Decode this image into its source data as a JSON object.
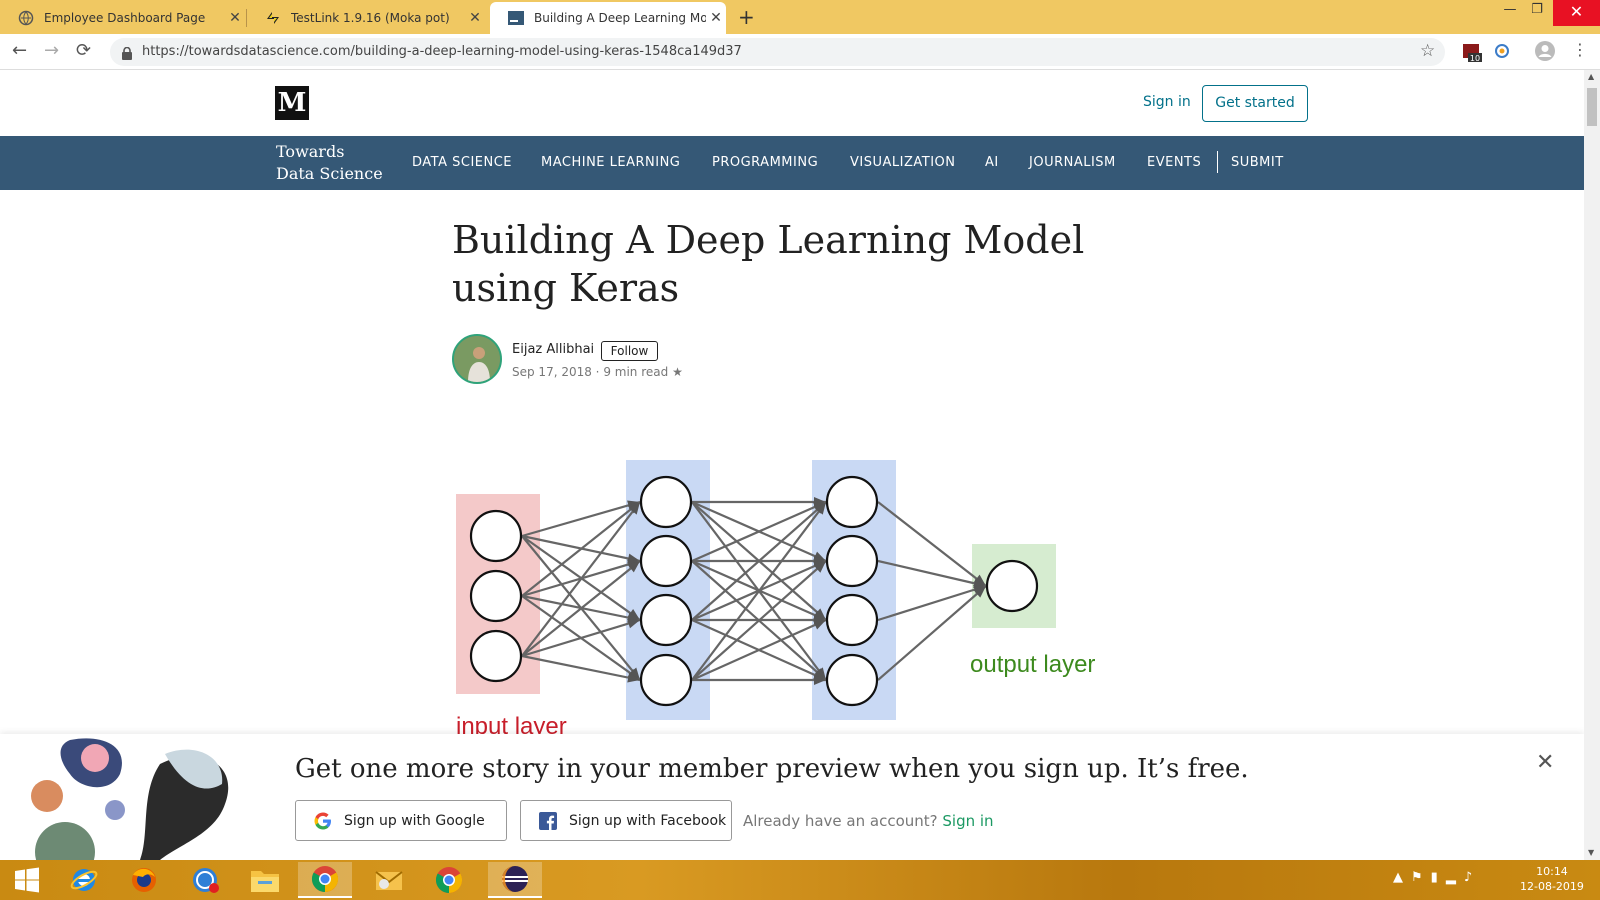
{
  "browser": {
    "tabs": [
      {
        "title": "Employee Dashboard Page",
        "active": false
      },
      {
        "title": "TestLink 1.9.16 (Moka pot)",
        "active": false
      },
      {
        "title": "Building A Deep Learning Model",
        "active": true
      }
    ],
    "url": "https://towardsdatascience.com/building-a-deep-learning-model-using-keras-1548ca149d37",
    "extension_badge": "10"
  },
  "site": {
    "logo": "M",
    "signin_label": "Sign in",
    "get_started_label": "Get started",
    "pub_name_line1": "Towards",
    "pub_name_line2": "Data Science",
    "nav": [
      "DATA SCIENCE",
      "MACHINE LEARNING",
      "PROGRAMMING",
      "VISUALIZATION",
      "AI",
      "JOURNALISM",
      "EVENTS",
      "SUBMIT"
    ]
  },
  "article": {
    "title": "Building A Deep Learning Model using Keras",
    "author": "Eijaz Allibhai",
    "follow_label": "Follow",
    "meta": "Sep 17, 2018 · 9 min read",
    "figure": {
      "input_label": "input layer",
      "output_label": "output layer",
      "layers": [
        3,
        4,
        4,
        1
      ]
    }
  },
  "banner": {
    "headline": "Get one more story in your member preview when you sign up. It’s free.",
    "google_label": "Sign up with Google",
    "facebook_label": "Sign up with Facebook",
    "already_text": "Already have an account?",
    "signin_link": "Sign in"
  },
  "taskbar": {
    "time": "10:14",
    "date": "12-08-2019"
  },
  "colors": {
    "titlebar": "#f0c862",
    "pub_nav": "#355876",
    "accent": "#03718a",
    "signin_green": "#1c9963",
    "input_layer": "#f4c9c9",
    "hidden_layer": "#c9d9f4",
    "output_layer": "#d6ecd0"
  }
}
